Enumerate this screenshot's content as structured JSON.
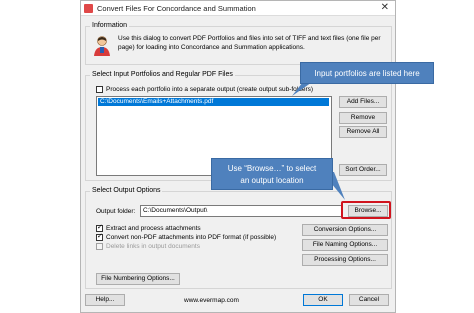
{
  "window": {
    "title": "Convert Files For Concordance and Summation",
    "close_glyph": "✕"
  },
  "information": {
    "label": "Information",
    "text_line1": "Use this dialog to convert PDF Portfolios and files into set of TIFF and text files (one file per",
    "text_line2": "page) for loading into Concordance and Summation applications."
  },
  "input": {
    "label": "Select Input Portfolios and Regular PDF Files",
    "separate_output_checkbox": "Process each portfolio into a separate output (create output sub-folders)",
    "selected_file": "C:\\Documents\\Emails+Attachments.pdf",
    "add_files": "Add Files...",
    "remove": "Remove",
    "remove_all": "Remove All",
    "sort_order": "Sort Order..."
  },
  "output": {
    "label": "Select Output Options",
    "folder_label": "Output folder:",
    "folder_value": "C:\\Documents\\Output\\",
    "browse": "Browse...",
    "extract_attachments": "Extract and process attachments",
    "convert_non_pdf": "Convert non-PDF attachments into PDF format (if possible)",
    "delete_links": "Delete links in output documents",
    "conversion_options": "Conversion Options...",
    "file_naming_options": "File Naming Options...",
    "processing_options": "Processing Options...",
    "file_numbering_options": "File Numbering Options..."
  },
  "footer": {
    "help": "Help...",
    "url": "www.evermap.com",
    "ok": "OK",
    "cancel": "Cancel"
  },
  "callouts": {
    "portfolios": "Input portfolios are listed here",
    "browse_line1": "Use “Browse…” to select",
    "browse_line2": "an output location"
  },
  "colors": {
    "callout": "#4f81bd",
    "highlight": "#d0141e",
    "selection": "#0078d7"
  }
}
